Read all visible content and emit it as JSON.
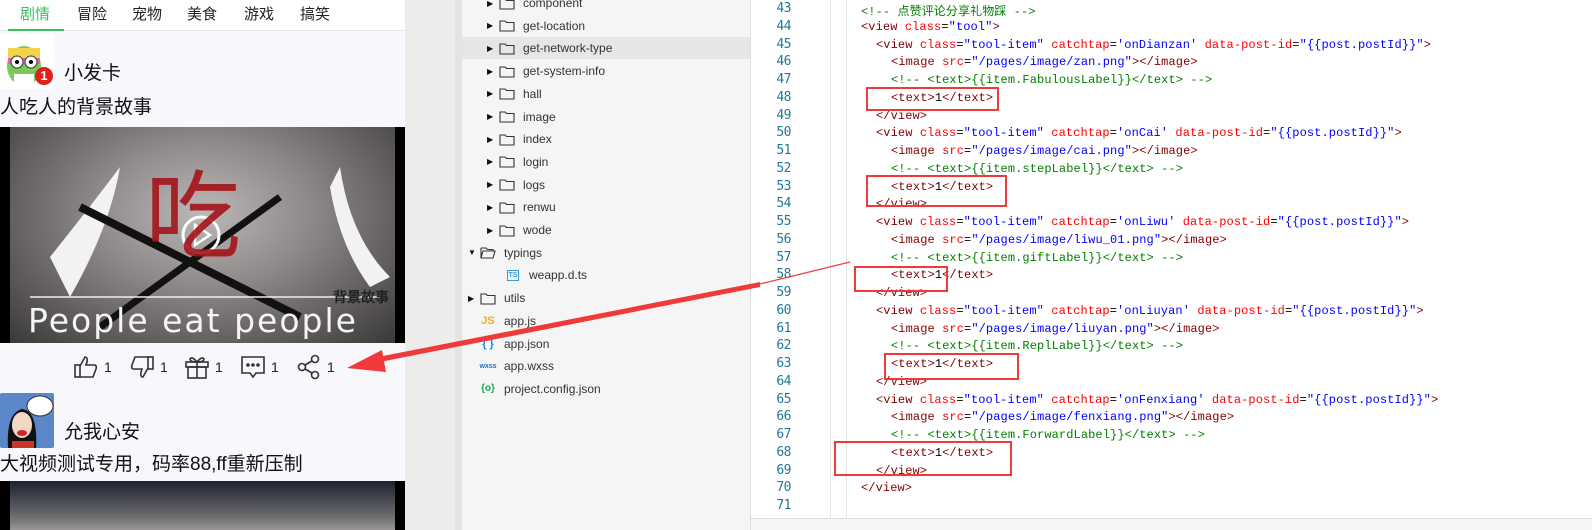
{
  "phone": {
    "tabs": [
      "剧情",
      "冒险",
      "宠物",
      "美食",
      "游戏",
      "搞笑"
    ],
    "active_tab": 0,
    "accent": "#3cbd63",
    "posts": [
      {
        "author": "小发卡",
        "badge": "1",
        "title": "人吃人的背景故事",
        "video_text": {
          "big": "吃",
          "caption": "People eat people",
          "corner": "背景故事"
        }
      },
      {
        "author": "允我心安",
        "title": "大视频测试专用，码率88,ff重新压制"
      }
    ],
    "toolbar": [
      {
        "icon": "thumbs-up-icon",
        "count": "1"
      },
      {
        "icon": "thumbs-down-icon",
        "count": "1"
      },
      {
        "icon": "gift-icon",
        "count": "1"
      },
      {
        "icon": "comment-icon",
        "count": "1"
      },
      {
        "icon": "share-icon",
        "count": "1"
      }
    ]
  },
  "tree": [
    {
      "label": "component",
      "type": "folder",
      "level": 1
    },
    {
      "label": "get-location",
      "type": "folder",
      "level": 1
    },
    {
      "label": "get-network-type",
      "type": "folder",
      "level": 1,
      "selected": true
    },
    {
      "label": "get-system-info",
      "type": "folder",
      "level": 1
    },
    {
      "label": "hall",
      "type": "folder",
      "level": 1
    },
    {
      "label": "image",
      "type": "folder",
      "level": 1
    },
    {
      "label": "index",
      "type": "folder",
      "level": 1
    },
    {
      "label": "login",
      "type": "folder",
      "level": 1
    },
    {
      "label": "logs",
      "type": "folder",
      "level": 1
    },
    {
      "label": "renwu",
      "type": "folder",
      "level": 1
    },
    {
      "label": "wode",
      "type": "folder",
      "level": 1
    },
    {
      "label": "typings",
      "type": "folder-open",
      "level": 0
    },
    {
      "label": "weapp.d.ts",
      "type": "ts",
      "level": 1
    },
    {
      "label": "utils",
      "type": "folder",
      "level": 0
    },
    {
      "label": "app.js",
      "type": "js",
      "level": 0
    },
    {
      "label": "app.json",
      "type": "json",
      "level": 0
    },
    {
      "label": "app.wxss",
      "type": "wxss",
      "level": 0
    },
    {
      "label": "project.config.json",
      "type": "config",
      "level": 0
    }
  ],
  "editor": {
    "lines": [
      {
        "n": "43",
        "i": 0,
        "s": [
          [
            "c",
            "<!-- 点赞评论分享礼物踩 -->"
          ]
        ]
      },
      {
        "n": "44",
        "i": 0,
        "s": [
          [
            "t",
            "<view "
          ],
          [
            "a",
            "class"
          ],
          [
            "p",
            "="
          ],
          [
            "v",
            "\"tool\""
          ],
          [
            "t",
            ">"
          ]
        ]
      },
      {
        "n": "45",
        "i": 1,
        "s": [
          [
            "t",
            "<view "
          ],
          [
            "a",
            "class"
          ],
          [
            "p",
            "="
          ],
          [
            "v",
            "\"tool-item\" "
          ],
          [
            "a",
            "catchtap"
          ],
          [
            "p",
            "="
          ],
          [
            "v",
            "'onDianzan' "
          ],
          [
            "a",
            "data-post-id"
          ],
          [
            "p",
            "="
          ],
          [
            "v",
            "\"{{post.postId}}\""
          ],
          [
            "t",
            ">"
          ]
        ]
      },
      {
        "n": "46",
        "i": 2,
        "s": [
          [
            "t",
            "<image "
          ],
          [
            "a",
            "src"
          ],
          [
            "p",
            "="
          ],
          [
            "v",
            "\"/pages/image/zan.png\""
          ],
          [
            "t",
            "></image>"
          ]
        ]
      },
      {
        "n": "47",
        "i": 2,
        "s": [
          [
            "c",
            "<!-- <text>{{item.FabulousLabel}}</text> -->"
          ]
        ]
      },
      {
        "n": "48",
        "i": 2,
        "s": [
          [
            "t",
            "<text>"
          ],
          [
            "p",
            "1"
          ],
          [
            "t",
            "</text>"
          ]
        ]
      },
      {
        "n": "49",
        "i": 1,
        "s": [
          [
            "t",
            "</view>"
          ]
        ]
      },
      {
        "n": "50",
        "i": 1,
        "s": [
          [
            "t",
            "<view "
          ],
          [
            "a",
            "class"
          ],
          [
            "p",
            "="
          ],
          [
            "v",
            "\"tool-item\" "
          ],
          [
            "a",
            "catchtap"
          ],
          [
            "p",
            "="
          ],
          [
            "v",
            "'onCai' "
          ],
          [
            "a",
            "data-post-id"
          ],
          [
            "p",
            "="
          ],
          [
            "v",
            "\"{{post.postId}}\""
          ],
          [
            "t",
            ">"
          ]
        ]
      },
      {
        "n": "51",
        "i": 2,
        "s": [
          [
            "t",
            "<image "
          ],
          [
            "a",
            "src"
          ],
          [
            "p",
            "="
          ],
          [
            "v",
            "\"/pages/image/cai.png\""
          ],
          [
            "t",
            "></image>"
          ]
        ]
      },
      {
        "n": "52",
        "i": 2,
        "s": [
          [
            "c",
            "<!-- <text>{{item.stepLabel}}</text> -->"
          ]
        ]
      },
      {
        "n": "53",
        "i": 2,
        "s": [
          [
            "t",
            "<text>"
          ],
          [
            "p",
            "1"
          ],
          [
            "t",
            "</text>"
          ]
        ]
      },
      {
        "n": "54",
        "i": 1,
        "s": [
          [
            "t",
            "</view>"
          ]
        ]
      },
      {
        "n": "55",
        "i": 1,
        "s": [
          [
            "t",
            "<view "
          ],
          [
            "a",
            "class"
          ],
          [
            "p",
            "="
          ],
          [
            "v",
            "\"tool-item\" "
          ],
          [
            "a",
            "catchtap"
          ],
          [
            "p",
            "="
          ],
          [
            "v",
            "'onLiwu' "
          ],
          [
            "a",
            "data-post-id"
          ],
          [
            "p",
            "="
          ],
          [
            "v",
            "\"{{post.postId}}\""
          ],
          [
            "t",
            ">"
          ]
        ]
      },
      {
        "n": "56",
        "i": 2,
        "s": [
          [
            "t",
            "<image "
          ],
          [
            "a",
            "src"
          ],
          [
            "p",
            "="
          ],
          [
            "v",
            "\"/pages/image/liwu_01.png\""
          ],
          [
            "t",
            "></image>"
          ]
        ]
      },
      {
        "n": "57",
        "i": 2,
        "s": [
          [
            "c",
            "<!-- <text>{{item.giftLabel}}</text> -->"
          ]
        ]
      },
      {
        "n": "58",
        "i": 2,
        "s": [
          [
            "t",
            "<text>"
          ],
          [
            "p",
            "1"
          ],
          [
            "t",
            "</text>"
          ]
        ]
      },
      {
        "n": "59",
        "i": 1,
        "s": [
          [
            "t",
            "</view>"
          ]
        ]
      },
      {
        "n": "60",
        "i": 1,
        "s": [
          [
            "t",
            "<view "
          ],
          [
            "a",
            "class"
          ],
          [
            "p",
            "="
          ],
          [
            "v",
            "\"tool-item\" "
          ],
          [
            "a",
            "catchtap"
          ],
          [
            "p",
            "="
          ],
          [
            "v",
            "'onLiuyan' "
          ],
          [
            "a",
            "data-post-id"
          ],
          [
            "p",
            "="
          ],
          [
            "v",
            "\"{{post.postId}}\""
          ],
          [
            "t",
            ">"
          ]
        ]
      },
      {
        "n": "61",
        "i": 2,
        "s": [
          [
            "t",
            "<image "
          ],
          [
            "a",
            "src"
          ],
          [
            "p",
            "="
          ],
          [
            "v",
            "\"/pages/image/liuyan.png\""
          ],
          [
            "t",
            "></image>"
          ]
        ]
      },
      {
        "n": "62",
        "i": 2,
        "s": [
          [
            "c",
            "<!-- <text>{{item.ReplLabel}}</text> -->"
          ]
        ]
      },
      {
        "n": "63",
        "i": 2,
        "s": [
          [
            "t",
            "<text>"
          ],
          [
            "p",
            "1"
          ],
          [
            "t",
            "</text>"
          ]
        ]
      },
      {
        "n": "64",
        "i": 1,
        "s": [
          [
            "t",
            "</view>"
          ]
        ]
      },
      {
        "n": "65",
        "i": 1,
        "s": [
          [
            "t",
            "<view "
          ],
          [
            "a",
            "class"
          ],
          [
            "p",
            "="
          ],
          [
            "v",
            "\"tool-item\" "
          ],
          [
            "a",
            "catchtap"
          ],
          [
            "p",
            "="
          ],
          [
            "v",
            "'onFenxiang' "
          ],
          [
            "a",
            "data-post-id"
          ],
          [
            "p",
            "="
          ],
          [
            "v",
            "\"{{post.postId}}\""
          ],
          [
            "t",
            ">"
          ]
        ]
      },
      {
        "n": "66",
        "i": 2,
        "s": [
          [
            "t",
            "<image "
          ],
          [
            "a",
            "src"
          ],
          [
            "p",
            "="
          ],
          [
            "v",
            "\"/pages/image/fenxiang.png\""
          ],
          [
            "t",
            "></image>"
          ]
        ]
      },
      {
        "n": "67",
        "i": 2,
        "s": [
          [
            "c",
            "<!-- <text>{{item.ForwardLabel}}</text> -->"
          ]
        ]
      },
      {
        "n": "68",
        "i": 2,
        "s": [
          [
            "t",
            "<text>"
          ],
          [
            "p",
            "1"
          ],
          [
            "t",
            "</text>"
          ]
        ]
      },
      {
        "n": "69",
        "i": 1,
        "s": [
          [
            "t",
            "</view>"
          ]
        ]
      },
      {
        "n": "70",
        "i": 0,
        "s": [
          [
            "t",
            "</view>"
          ]
        ]
      },
      {
        "n": "71",
        "i": 0,
        "s": []
      }
    ]
  },
  "annotation_color": "#f03a3a"
}
